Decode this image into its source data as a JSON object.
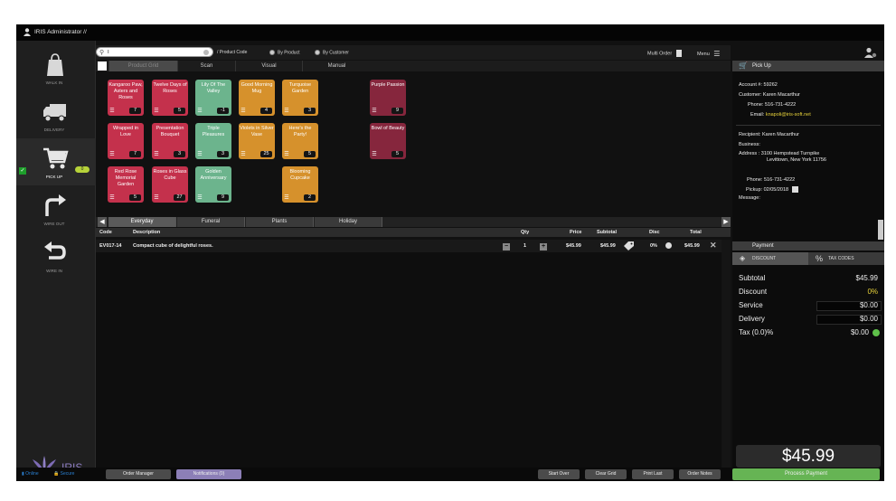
{
  "app": {
    "title": "IRIS Administrator //"
  },
  "nav": {
    "items": [
      {
        "label": "WALK IN",
        "icon": "bag-icon"
      },
      {
        "label": "DELIVERY",
        "icon": "truck-icon"
      },
      {
        "label": "PICK UP",
        "icon": "cart-icon",
        "badge": "0",
        "selected": true
      },
      {
        "label": "WIRE OUT",
        "icon": "wire-out-icon"
      },
      {
        "label": "WIRE IN",
        "icon": "wire-in-icon"
      }
    ],
    "logo_text": "IRIS"
  },
  "search": {
    "value": "T",
    "mode_label": "/ Product Code",
    "by_product": "By Product",
    "by_customer": "By Customer"
  },
  "toolbar": {
    "multi_order": "Multi Order",
    "menu": "Menu"
  },
  "top_tabs": [
    "Product Grid",
    "Scan",
    "Visual",
    "Manual"
  ],
  "products": [
    {
      "name": "Kangaroo Paw, Asters and Roses",
      "count": "7",
      "color": "red"
    },
    {
      "name": "Twelve Days of Roses",
      "count": "5",
      "color": "red"
    },
    {
      "name": "Lily Of The Valley",
      "count": "-1",
      "color": "green"
    },
    {
      "name": "Good Morning Mug",
      "count": "4",
      "color": "orange"
    },
    {
      "name": "Turquoise Garden",
      "count": "3",
      "color": "orange"
    },
    {
      "name": "Purple Passion",
      "count": "9",
      "color": "plum"
    },
    {
      "name": "Wrapped in Love",
      "count": "7",
      "color": "red"
    },
    {
      "name": "Presentation Bouquet",
      "count": "3",
      "color": "red"
    },
    {
      "name": "Triple Pleasures",
      "count": "3",
      "color": "green"
    },
    {
      "name": "Violets in Silver Vase",
      "count": "25",
      "color": "orange"
    },
    {
      "name": "Here's the Party!",
      "count": "5",
      "color": "orange"
    },
    {
      "name": "Bowl of Beauty",
      "count": "5",
      "color": "plum"
    },
    {
      "name": "Red Rose Memorial Garden",
      "count": "5",
      "color": "red"
    },
    {
      "name": "Roses in Glass Cube",
      "count": "27",
      "color": "red"
    },
    {
      "name": "Golden Anniversary",
      "count": "9",
      "color": "green"
    },
    {
      "name": "Blooming Cupcake",
      "count": "2",
      "color": "orange"
    }
  ],
  "category_tabs": [
    "Everyday",
    "Funeral",
    "Plants",
    "Holiday"
  ],
  "order": {
    "headers": {
      "code": "Code",
      "description": "Description",
      "qty": "Qty",
      "price": "Price",
      "subtotal": "Subtotal",
      "disc": "Disc",
      "total": "Total"
    },
    "rows": [
      {
        "code": "EV017-14",
        "description": "Compact cube of delightful roses.",
        "qty": "1",
        "price": "$45.99",
        "subtotal": "$45.99",
        "disc": "0%",
        "total": "$45.99"
      }
    ]
  },
  "pickup": {
    "title": "Pick Up",
    "account_label": "Account #:",
    "account": "59262",
    "customer_label": "Customer:",
    "customer": "Karen Macarthur",
    "phone_label": "Phone:",
    "phone": "516-731-4222",
    "email_label": "Email:",
    "email": "knapoli@iris-soft.net",
    "recipient_label": "Recipient:",
    "recipient": "Karen Macarthur",
    "business_label": "Business:",
    "address_label": "Address :",
    "address1": "3100 Hempstead Turnpike",
    "address2": "Levittown, New York 11756",
    "rphone_label": "Phone:",
    "rphone": "516-731-4222",
    "pickup_label": "Pickup:",
    "pickup_date": "02/05/2018",
    "message_label": "Message:"
  },
  "payment": {
    "title": "Payment",
    "discount_tab": "DISCOUNT",
    "tax_tab": "TAX CODES",
    "subtotal_label": "Subtotal",
    "subtotal": "$45.99",
    "discount_label": "Discount",
    "discount": "0%",
    "service_label": "Service",
    "service": "$0.00",
    "delivery_label": "Delivery",
    "delivery": "$0.00",
    "tax_label": "Tax (0.0)%",
    "tax": "$0.00",
    "grand_total": "$45.99",
    "process": "Process Payment"
  },
  "status": {
    "online": "Online",
    "secure": "Secure",
    "order_manager": "Order Manager",
    "notifications": "Notifications (0)",
    "start_over": "Start Over",
    "clear_grid": "Clear Grid",
    "print_last": "Print Last",
    "order_notes": "Order Notes"
  },
  "colors": {
    "red": "#c4314c",
    "green": "#6cb48d",
    "orange": "#d6912c",
    "plum": "#86263d",
    "accent_yellow": "#e7d23a",
    "process_green": "#66b454"
  }
}
